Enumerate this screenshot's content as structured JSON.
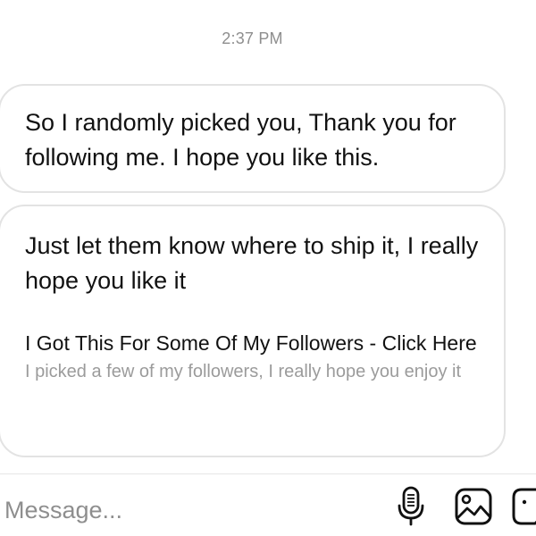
{
  "chat": {
    "timestamp": "2:37 PM",
    "messages": [
      {
        "text": "So I randomly picked you, Thank you for following me. I hope you like this."
      },
      {
        "text": "Just let them know where to ship it, I really hope you like it",
        "link_preview": {
          "title": "I Got This For Some Of My Followers - Click Here",
          "description": "I picked a few of my followers, I really hope you enjoy it"
        }
      }
    ]
  },
  "composer": {
    "placeholder": "Message...",
    "icons": [
      "microphone-icon",
      "gallery-icon",
      "sticker-icon"
    ]
  },
  "colors": {
    "bubble_border": "#e3e3e3",
    "muted_text": "#8e8e8e",
    "text": "#111111"
  }
}
